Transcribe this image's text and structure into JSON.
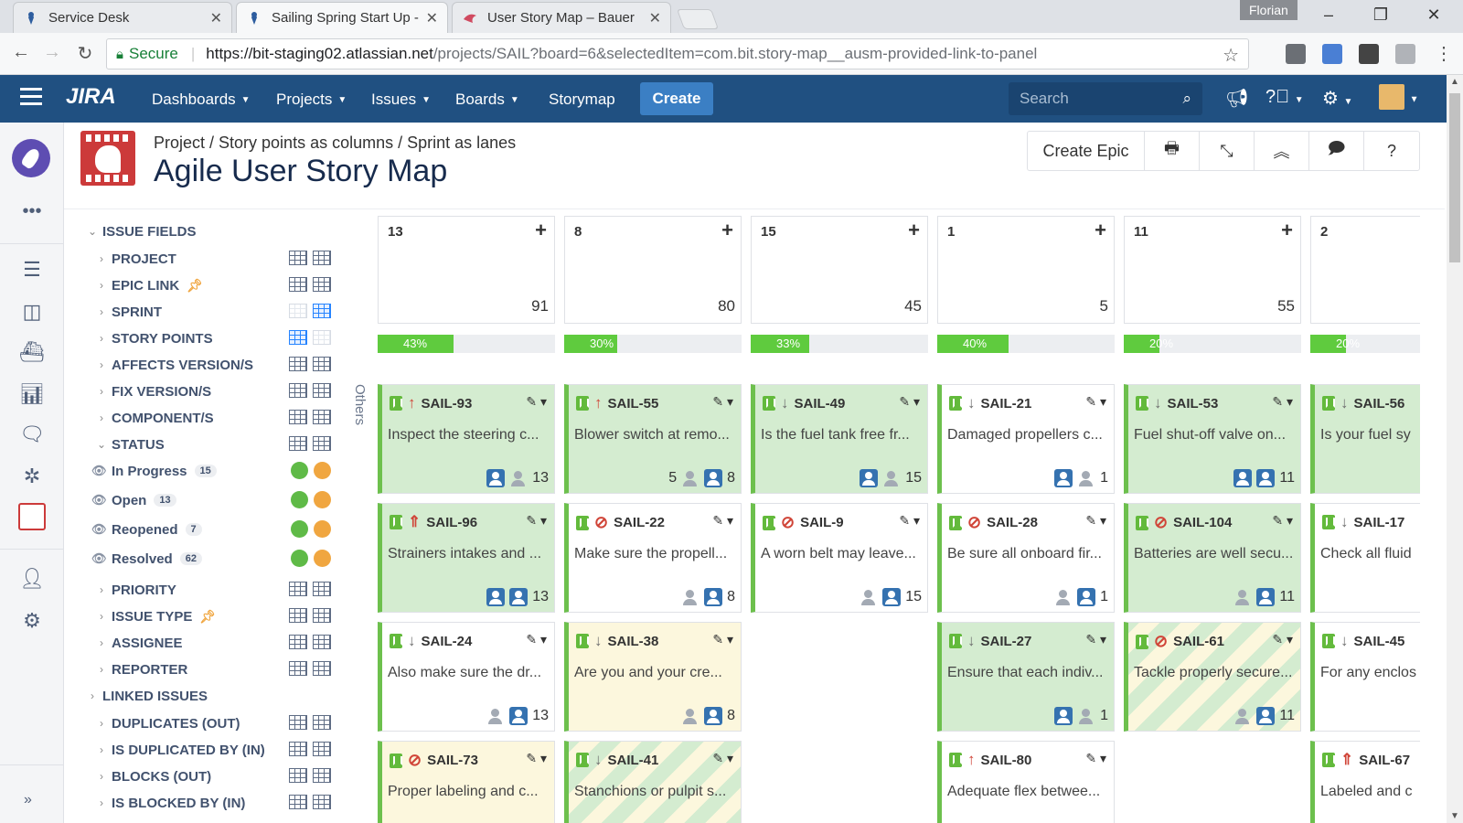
{
  "browser": {
    "tabs": [
      {
        "label": "Service Desk"
      },
      {
        "label": "Sailing Spring Start Up -"
      },
      {
        "label": "User Story Map – Bauer"
      }
    ],
    "user": "Florian",
    "secure_label": "Secure",
    "url_host": "https://bit-staging02.atlassian.net",
    "url_path": "/projects/SAIL?board=6&selectedItem=com.bit.story-map__ausm-provided-link-to-panel"
  },
  "jira": {
    "logo": "JIRA",
    "nav": [
      "Dashboards",
      "Projects",
      "Issues",
      "Boards",
      "Storymap"
    ],
    "create_label": "Create",
    "search_placeholder": "Search"
  },
  "page": {
    "breadcrumb": "Project / Story points as columns / Sprint as lanes",
    "title": "Agile User Story Map",
    "create_epic": "Create Epic"
  },
  "fields": {
    "issue_fields": "ISSUE FIELDS",
    "items": [
      "PROJECT",
      "EPIC LINK",
      "SPRINT",
      "STORY POINTS",
      "AFFECTS VERSION/S",
      "FIX VERSION/S",
      "COMPONENT/S",
      "STATUS"
    ],
    "statuses": [
      {
        "label": "In Progress",
        "count": "15"
      },
      {
        "label": "Open",
        "count": "13"
      },
      {
        "label": "Reopened",
        "count": "7"
      },
      {
        "label": "Resolved",
        "count": "62"
      }
    ],
    "items2": [
      "PRIORITY",
      "ISSUE TYPE",
      "ASSIGNEE",
      "REPORTER"
    ],
    "linked_issues": "LINKED ISSUES",
    "links": [
      "DUPLICATES (OUT)",
      "IS DUPLICATED BY (IN)",
      "BLOCKS (OUT)",
      "IS BLOCKED BY (IN)"
    ],
    "colors": {
      "green": "#5fba47",
      "orange": "#f0a640"
    }
  },
  "board": {
    "others_label": "Others",
    "columns": [
      {
        "name": "13",
        "total": "91",
        "progress_label": "43%",
        "progress": 0.43
      },
      {
        "name": "8",
        "total": "80",
        "progress_label": "30%",
        "progress": 0.3
      },
      {
        "name": "15",
        "total": "45",
        "progress_label": "33%",
        "progress": 0.33
      },
      {
        "name": "1",
        "total": "5",
        "progress_label": "40%",
        "progress": 0.4
      },
      {
        "name": "11",
        "total": "55",
        "progress_label": "20%",
        "progress": 0.2
      },
      {
        "name": "2",
        "total": "",
        "progress_label": "20%",
        "progress": 0.2
      }
    ],
    "cards": {
      "c0r0": {
        "key": "SAIL-93",
        "summary": "Inspect the steering c...",
        "points": "13"
      },
      "c0r1": {
        "key": "SAIL-96",
        "summary": "Strainers intakes and ...",
        "points": "13"
      },
      "c0r2": {
        "key": "SAIL-24",
        "summary": "Also make sure the dr...",
        "points": "13"
      },
      "c0r3": {
        "key": "SAIL-73",
        "summary": "Proper labeling and c...",
        "points": ""
      },
      "c1r0": {
        "key": "SAIL-55",
        "summary": "Blower switch at remo...",
        "points": "8",
        "prefix": "5"
      },
      "c1r1": {
        "key": "SAIL-22",
        "summary": "Make sure the propell...",
        "points": "8"
      },
      "c1r2": {
        "key": "SAIL-38",
        "summary": "Are you and your cre...",
        "points": "8"
      },
      "c1r3": {
        "key": "SAIL-41",
        "summary": "Stanchions or pulpit s...",
        "points": ""
      },
      "c2r0": {
        "key": "SAIL-49",
        "summary": "Is the fuel tank free fr...",
        "points": "15"
      },
      "c2r1": {
        "key": "SAIL-9",
        "summary": "A worn belt may leave...",
        "points": "15"
      },
      "c3r0": {
        "key": "SAIL-21",
        "summary": "Damaged propellers c...",
        "points": "1"
      },
      "c3r1": {
        "key": "SAIL-28",
        "summary": "Be sure all onboard fir...",
        "points": "1"
      },
      "c3r2": {
        "key": "SAIL-27",
        "summary": "Ensure that each indiv...",
        "points": "1"
      },
      "c3r3": {
        "key": "SAIL-80",
        "summary": "Adequate flex betwee...",
        "points": ""
      },
      "c4r0": {
        "key": "SAIL-53",
        "summary": "Fuel shut-off valve on...",
        "points": "11"
      },
      "c4r1": {
        "key": "SAIL-104",
        "summary": "Batteries are well secu...",
        "points": "11"
      },
      "c4r2": {
        "key": "SAIL-61",
        "summary": "Tackle properly secure...",
        "points": "11"
      },
      "c5r0": {
        "key": "SAIL-56",
        "summary": "Is your fuel sy",
        "points": ""
      },
      "c5r1": {
        "key": "SAIL-17",
        "summary": "Check all fluid",
        "points": ""
      },
      "c5r2": {
        "key": "SAIL-45",
        "summary": "For any enclos",
        "points": ""
      },
      "c5r3": {
        "key": "SAIL-67",
        "summary": "Labeled and c",
        "points": ""
      }
    }
  }
}
